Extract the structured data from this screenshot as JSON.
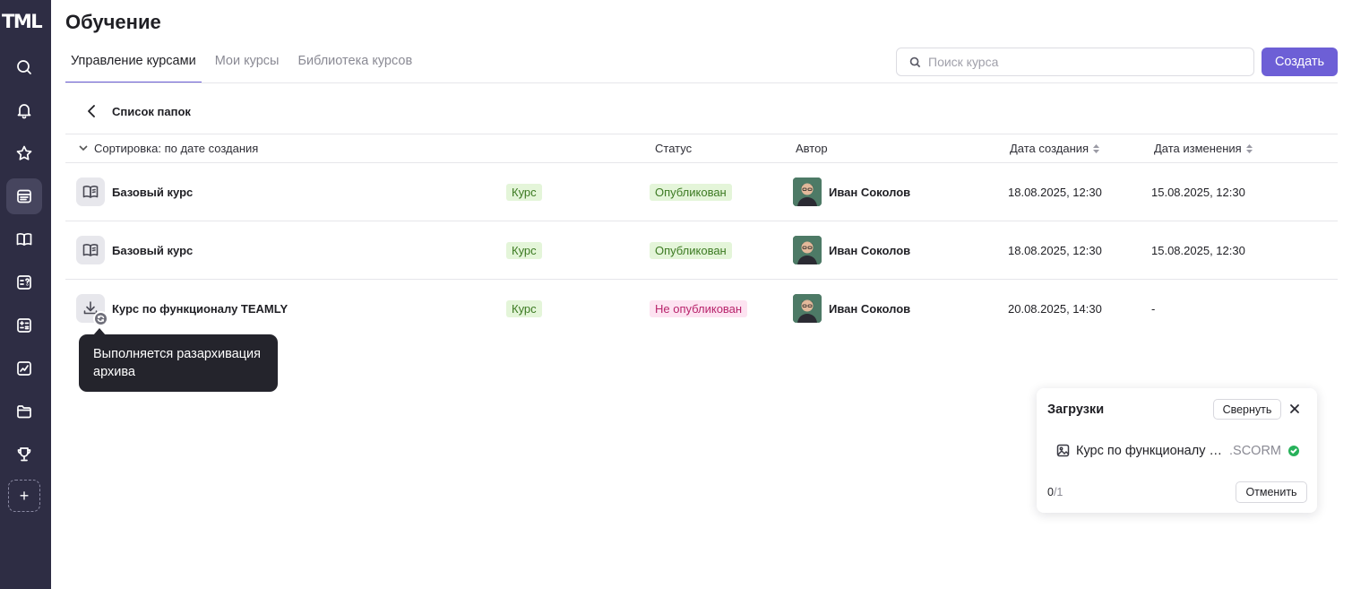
{
  "app": {
    "logo": "TML",
    "title": "Обучение"
  },
  "tabs": [
    {
      "label": "Управление курсами",
      "active": true
    },
    {
      "label": "Мои курсы",
      "active": false
    },
    {
      "label": "Библиотека курсов",
      "active": false
    }
  ],
  "search": {
    "placeholder": "Поиск курса",
    "value": ""
  },
  "create_label": "Создать",
  "folder": {
    "back_label": "Список папок"
  },
  "table": {
    "headers": {
      "sort": "Сортировка: по дате создания",
      "status": "Статус",
      "author": "Автор",
      "created": "Дата создания",
      "changed": "Дата изменения"
    },
    "rows": [
      {
        "name": "Базовый курс",
        "type": "Курс",
        "status": "Опубликован",
        "author": "Иван Соколов",
        "created": "18.08.2025, 12:30",
        "changed": "15.08.2025, 12:30"
      },
      {
        "name": "Базовый курс",
        "type": "Курс",
        "status": "Опубликован",
        "author": "Иван Соколов",
        "created": "18.08.2025, 12:30",
        "changed": "15.08.2025, 12:30"
      },
      {
        "name": "Курс по функционалу TEAMLY",
        "type": "Курс",
        "status": "Не опубликован",
        "author": "Иван Соколов",
        "created": "20.08.2025, 14:30",
        "changed": "-"
      }
    ]
  },
  "tooltip": "Выполняется разархивация архива",
  "uploads": {
    "title": "Загрузки",
    "collapse_label": "Свернуть",
    "file_name": "Курс по функционалу TEAMLY",
    "file_ext": ".SCORM",
    "done": "0",
    "total": "/1",
    "cancel_label": "Отменить"
  },
  "colors": {
    "sidebar": "#2e2d44",
    "accent": "#6d5fd6",
    "published_bg": "#e4f5d9",
    "unpublished_bg": "#fde3f1",
    "success": "#27b15a"
  },
  "icons": [
    "search-icon",
    "bell-icon",
    "star-icon",
    "courses-icon",
    "book-icon",
    "quiz-icon",
    "calculator-icon",
    "chart-icon",
    "folder-icon",
    "trophy-icon",
    "plus-icon"
  ]
}
